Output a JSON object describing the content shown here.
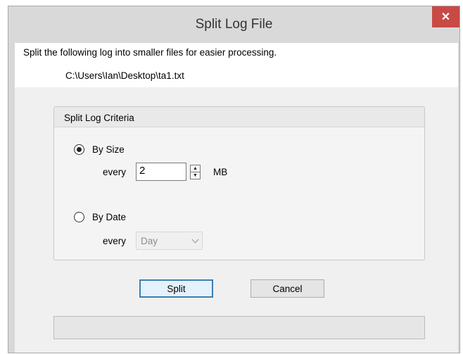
{
  "window": {
    "title": "Split Log File",
    "close_glyph": "✕"
  },
  "info": {
    "description": "Split the following log into smaller files for easier processing.",
    "path": "C:\\Users\\Ian\\Desktop\\ta1.txt"
  },
  "criteria": {
    "group_label": "Split Log Criteria",
    "by_size": {
      "label": "By Size",
      "selected": true,
      "every_label": "every",
      "value": "2",
      "unit": "MB"
    },
    "by_date": {
      "label": "By Date",
      "selected": false,
      "every_label": "every",
      "selected_option": "Day",
      "enabled": false
    }
  },
  "buttons": {
    "split_label": "Split",
    "cancel_label": "Cancel"
  },
  "progress": {
    "value": 0
  },
  "colors": {
    "close_button": "#c84a45",
    "default_button_border": "#3c7fb1"
  }
}
